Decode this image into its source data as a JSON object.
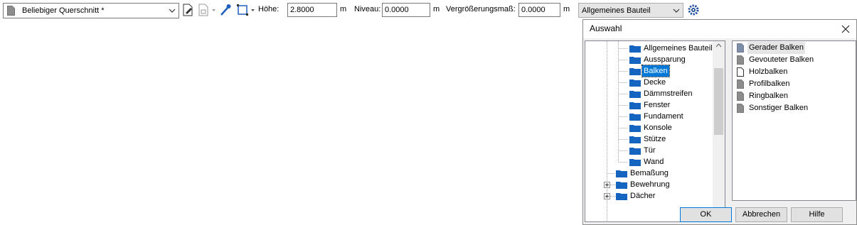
{
  "toolbar": {
    "section_combo": "Beliebiger Querschnitt *",
    "hoehe_label": "Höhe:",
    "hoehe_value": "2.8000",
    "hoehe_unit": "m",
    "niveau_label": "Niveau:",
    "niveau_value": "0.0000",
    "niveau_unit": "m",
    "scale_label": "Vergrößerungsmaß:",
    "scale_value": "0.0000",
    "scale_unit": "m",
    "component_combo": "Allgemeines Bauteil"
  },
  "dialog": {
    "title": "Auswahl",
    "tree": [
      {
        "label": "Allgemeines Bauteil",
        "level": 1
      },
      {
        "label": "Aussparung",
        "level": 1
      },
      {
        "label": "Balken",
        "level": 1,
        "selected": true
      },
      {
        "label": "Decke",
        "level": 1
      },
      {
        "label": "Dämmstreifen",
        "level": 1
      },
      {
        "label": "Fenster",
        "level": 1
      },
      {
        "label": "Fundament",
        "level": 1
      },
      {
        "label": "Konsole",
        "level": 1
      },
      {
        "label": "Stütze",
        "level": 1
      },
      {
        "label": "Tür",
        "level": 1
      },
      {
        "label": "Wand",
        "level": 1
      },
      {
        "label": "Bemaßung",
        "level": 0
      },
      {
        "label": "Bewehrung",
        "level": 0,
        "expandable": true
      },
      {
        "label": "Dächer",
        "level": 0,
        "expandable": true
      }
    ],
    "list": [
      {
        "label": "Gerader Balken",
        "highlighted": true
      },
      {
        "label": "Gevouteter Balken"
      },
      {
        "label": "Holzbalken"
      },
      {
        "label": "Profilbalken"
      },
      {
        "label": "Ringbalken"
      },
      {
        "label": "Sonstiger Balken"
      }
    ],
    "buttons": {
      "ok": "OK",
      "cancel": "Abbrechen",
      "help": "Hilfe"
    }
  },
  "colors": {
    "selection": "#0078d7",
    "folder": "#1565c0",
    "dialog_bg": "#f0f0f0"
  }
}
